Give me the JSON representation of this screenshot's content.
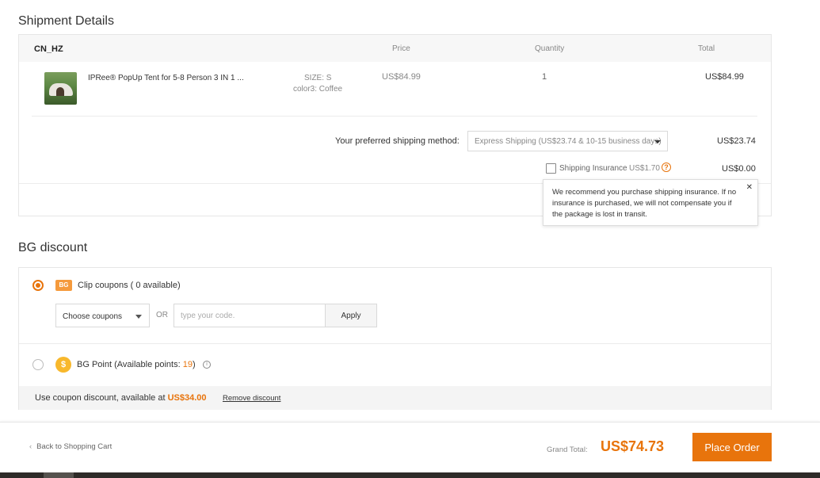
{
  "shipment": {
    "title": "Shipment Details",
    "warehouse": "CN_HZ",
    "headers": {
      "price": "Price",
      "quantity": "Quantity",
      "total": "Total"
    },
    "product": {
      "name": "IPRee® PopUp Tent for 5-8 Person 3 IN 1 ...",
      "size": "SIZE: S",
      "color": "color3: Coffee",
      "price": "US$84.99",
      "quantity": "1",
      "total": "US$84.99"
    },
    "shipping_label": "Your preferred shipping method:",
    "shipping_method": "Express Shipping (US$23.74 & 10-15 business days)",
    "shipping_cost": "US$23.74",
    "insurance_label": "Shipping Insurance",
    "insurance_price": "US$1.70",
    "insurance_total": "US$0.00",
    "tooltip": "We recommend you purchase shipping insurance. If no insurance is purchased, we will not compensate you if the package is lost in transit."
  },
  "discount": {
    "title": "BG discount",
    "coupon_badge": "BG",
    "coupon_label": "Clip coupons ( 0 available)",
    "choose_coupons": "Choose coupons",
    "or": "OR",
    "code_placeholder": "type your code.",
    "apply": "Apply",
    "point_badge": "$",
    "point_label_prefix": "BG Point (Available points: ",
    "points": "19",
    "point_label_suffix": ")",
    "use_coupon_text": "Use coupon discount, available at ",
    "coupon_amount": "US$34.00",
    "remove": "Remove discount"
  },
  "footer": {
    "back": "Back to Shopping Cart",
    "grand_total_label": "Grand Total:",
    "grand_total": "US$74.73",
    "place_order": "Place Order"
  },
  "colors": {
    "accent": "#e8740c",
    "coin": "#f8b82c"
  },
  "icons": [
    "chevron-down-icon",
    "help-icon",
    "close-icon",
    "coupon-icon",
    "coin-icon",
    "info-icon",
    "chevron-left-icon"
  ]
}
